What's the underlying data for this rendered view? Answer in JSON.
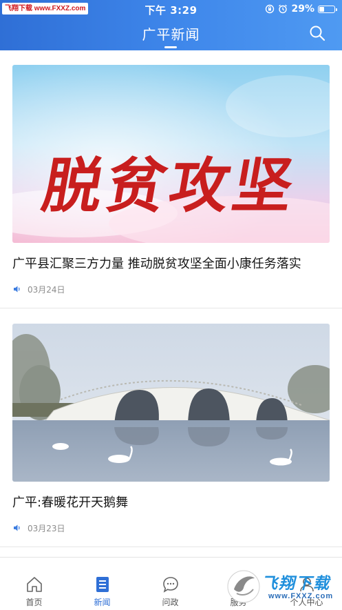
{
  "status_bar": {
    "watermark": "飞翔下载 www.FXXZ.com",
    "time": "下午 3:29",
    "battery_percent": "29%",
    "battery_level": 0.29,
    "icons": [
      "rotation-lock-icon",
      "alarm-icon",
      "battery-icon"
    ]
  },
  "header": {
    "title": "广平新闻",
    "search_icon": "search-icon"
  },
  "news": [
    {
      "image_caption": "脱贫攻坚",
      "title": "广平县汇聚三方力量 推动脱贫攻坚全面小康任务落实",
      "date": "03月24日"
    },
    {
      "image_caption": "",
      "title": "广平:春暖花开天鹅舞",
      "date": "03月23日"
    }
  ],
  "tabbar": {
    "tabs": [
      {
        "label": "首页",
        "icon": "home-icon",
        "active": false
      },
      {
        "label": "新闻",
        "icon": "news-icon",
        "active": true
      },
      {
        "label": "问政",
        "icon": "chat-bubble-icon",
        "active": false
      },
      {
        "label": "服务",
        "icon": "service-icon",
        "active": false
      },
      {
        "label": "个人中心",
        "icon": "user-icon",
        "active": false
      }
    ]
  },
  "logo_watermark": {
    "main": "飞翔下载",
    "sub": "www.FXXZ.com"
  },
  "colors": {
    "header_start": "#2f6fd6",
    "header_end": "#4f9af2",
    "accent": "#2f6fd6"
  }
}
